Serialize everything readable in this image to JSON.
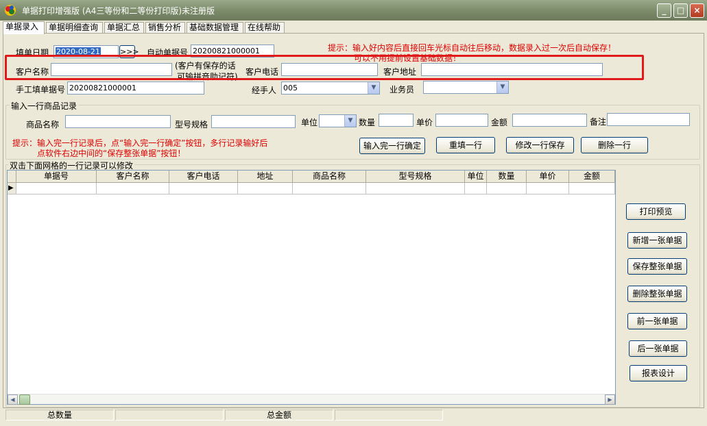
{
  "window": {
    "title": "单据打印增强版 (A4三等份和二等份打印版)未注册版"
  },
  "tabs": [
    "单据录入",
    "单据明细查询",
    "单据汇总",
    "销售分析",
    "基础数据管理",
    "在线帮助"
  ],
  "header": {
    "fill_date_label": "填单日期",
    "fill_date_value": "2020-08-21",
    "date_button": ">>>",
    "auto_no_label": "自动单据号",
    "auto_no_value": "20200821000001",
    "hint_line1": "提示：输入好内容后直接回车光标自动往后移动，数据录入过一次后自动保存！",
    "hint_line2": "可以不用提前设置基础数据！",
    "customer_name_label": "客户名称",
    "customer_note_line1": "(客户有保存的话",
    "customer_note_line2": "可输拼音助记符)",
    "customer_phone_label": "客户电话",
    "customer_address_label": "客户地址",
    "manual_no_label": "手工填单据号",
    "manual_no_value": "20200821000001",
    "handler_label": "经手人",
    "handler_value": "005",
    "salesman_label": "业务员",
    "salesman_value": ""
  },
  "item_entry": {
    "group_title": "输入一行商品记录",
    "product_name_label": "商品名称",
    "model_label": "型号规格",
    "unit_label": "单位",
    "qty_label": "数量",
    "price_label": "单价",
    "amount_label": "金额",
    "remark_label": "备注",
    "hint_line1": "提示：输入完一行记录后，点“输入完一行确定”按钮，多行记录输好后",
    "hint_line2": "点软件右边中间的“保存整张单据”按钮！",
    "btn_confirm": "输入完一行确定",
    "btn_refill": "重填一行",
    "btn_modify": "修改一行保存",
    "btn_delete": "删除一行"
  },
  "grid": {
    "caption": "双击下面网格的一行记录可以修改",
    "columns": [
      "单据号",
      "客户名称",
      "客户电话",
      "地址",
      "商品名称",
      "型号规格",
      "单位",
      "数量",
      "单价",
      "金额"
    ],
    "row_indicator": "▶"
  },
  "side_buttons": [
    "打印预览",
    "新增一张单据",
    "保存整张单据",
    "删除整张单据",
    "前一张单据",
    "后一张单据",
    "报表设计"
  ],
  "status": {
    "total_qty_label": "总数量",
    "total_amount_label": "总金额"
  }
}
